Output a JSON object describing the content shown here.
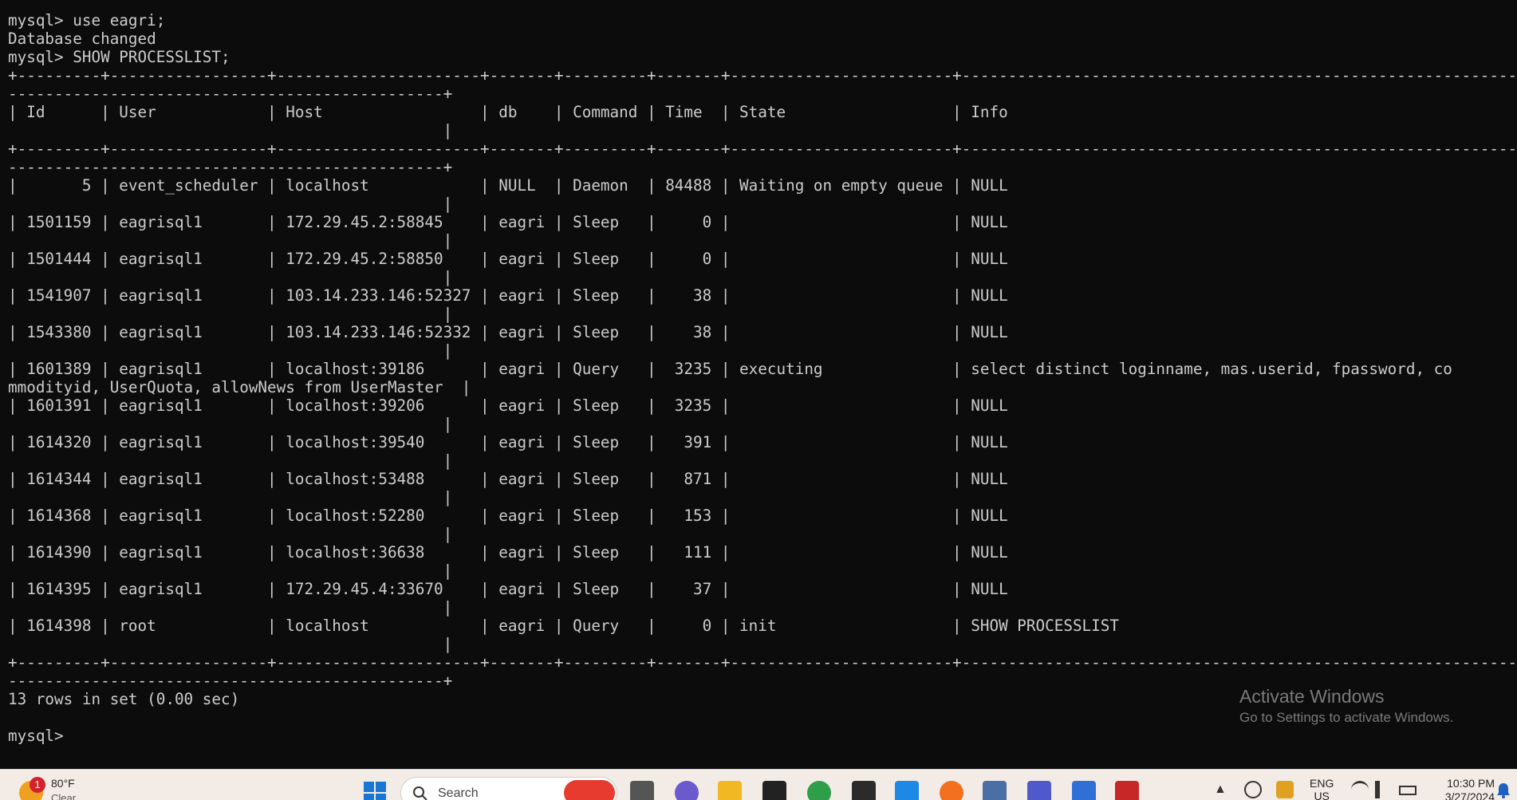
{
  "terminal": {
    "lines": [
      "mysql> use eagri;",
      "Database changed",
      "mysql> SHOW PROCESSLIST;",
      "+---------+-----------------+----------------------+-------+---------+-------+------------------------+--------------------------------------------------------------",
      "-----------------------------------------------+",
      "| Id      | User            | Host                 | db    | Command | Time  | State                  | Info",
      "                                               |",
      "+---------+-----------------+----------------------+-------+---------+-------+------------------------+--------------------------------------------------------------",
      "-----------------------------------------------+",
      "|       5 | event_scheduler | localhost            | NULL  | Daemon  | 84488 | Waiting on empty queue | NULL",
      "                                               |",
      "| 1501159 | eagrisql1       | 172.29.45.2:58845    | eagri | Sleep   |     0 |                        | NULL",
      "                                               |",
      "| 1501444 | eagrisql1       | 172.29.45.2:58850    | eagri | Sleep   |     0 |                        | NULL",
      "                                               |",
      "| 1541907 | eagrisql1       | 103.14.233.146:52327 | eagri | Sleep   |    38 |                        | NULL",
      "                                               |",
      "| 1543380 | eagrisql1       | 103.14.233.146:52332 | eagri | Sleep   |    38 |                        | NULL",
      "                                               |",
      "| 1601389 | eagrisql1       | localhost:39186      | eagri | Query   |  3235 | executing              | select distinct loginname, mas.userid, fpassword, co",
      "mmodityid, UserQuota, allowNews from UserMaster  |",
      "| 1601391 | eagrisql1       | localhost:39206      | eagri | Sleep   |  3235 |                        | NULL",
      "                                               |",
      "| 1614320 | eagrisql1       | localhost:39540      | eagri | Sleep   |   391 |                        | NULL",
      "                                               |",
      "| 1614344 | eagrisql1       | localhost:53488      | eagri | Sleep   |   871 |                        | NULL",
      "                                               |",
      "| 1614368 | eagrisql1       | localhost:52280      | eagri | Sleep   |   153 |                        | NULL",
      "                                               |",
      "| 1614390 | eagrisql1       | localhost:36638      | eagri | Sleep   |   111 |                        | NULL",
      "                                               |",
      "| 1614395 | eagrisql1       | 172.29.45.4:33670    | eagri | Sleep   |    37 |                        | NULL",
      "                                               |",
      "| 1614398 | root            | localhost            | eagri | Query   |     0 | init                   | SHOW PROCESSLIST",
      "                                               |",
      "+---------+-----------------+----------------------+-------+---------+-------+------------------------+--------------------------------------------------------------",
      "-----------------------------------------------+",
      "13 rows in set (0.00 sec)",
      "",
      "mysql> "
    ]
  },
  "watermark": {
    "title": "Activate Windows",
    "subtitle": "Go to Settings to activate Windows."
  },
  "taskbar": {
    "weather": {
      "badge": "1",
      "temp": "80°F",
      "condition": "Clear"
    },
    "search": {
      "label": "Search"
    },
    "apps": [
      "task-view-icon",
      "video-call-icon",
      "file-explorer-icon",
      "sticky-app-icon",
      "chrome-icon",
      "terminal-icon",
      "vscode-icon",
      "paint-app-icon",
      "calculator-icon",
      "teams-icon",
      "notepad-icon",
      "app-icon"
    ],
    "tray": {
      "language": "ENG",
      "region": "US",
      "time": "10:30 PM",
      "date": "3/27/2024"
    }
  },
  "colors": {
    "terminal_bg": "#0c0c0c",
    "terminal_fg": "#cccccc",
    "taskbar_bg": "#f3ece6"
  }
}
